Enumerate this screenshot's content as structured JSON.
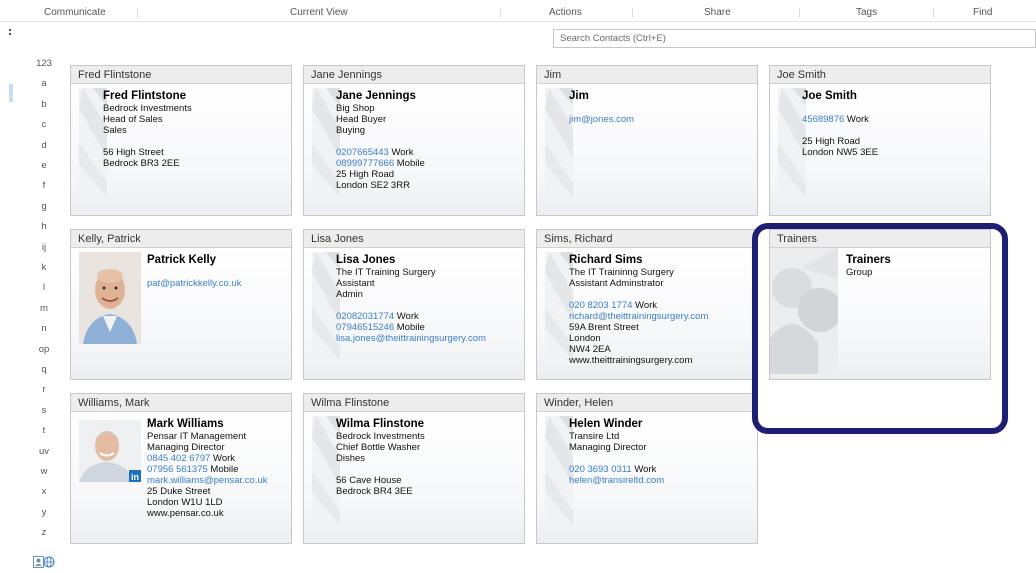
{
  "ribbon": {
    "groups": [
      "Communicate",
      "Current View",
      "Actions",
      "Share",
      "Tags",
      "Find"
    ]
  },
  "search": {
    "placeholder": "Search Contacts (Ctrl+E)"
  },
  "alphabet": [
    "123",
    "a",
    "b",
    "c",
    "d",
    "e",
    "f",
    "g",
    "h",
    "ij",
    "k",
    "l",
    "m",
    "n",
    "op",
    "q",
    "r",
    "s",
    "t",
    "uv",
    "w",
    "x",
    "y",
    "z"
  ],
  "cards": [
    {
      "header": "Fred Flintstone",
      "name": "Fred Flintstone",
      "lines": [
        {
          "text": "Bedrock Investments"
        },
        {
          "text": "Head of Sales"
        },
        {
          "text": "Sales"
        },
        {
          "gap": true
        },
        {
          "text": "56 High Street"
        },
        {
          "text": "Bedrock BR3 2EE"
        }
      ]
    },
    {
      "header": "Jane Jennings",
      "name": "Jane Jennings",
      "lines": [
        {
          "text": "Big Shop"
        },
        {
          "text": "Head Buyer"
        },
        {
          "text": "Buying"
        },
        {
          "gap": true
        },
        {
          "link": "0207665443",
          "suffix": " Work"
        },
        {
          "link": "08999777666",
          "suffix": " Mobile"
        },
        {
          "text": "25 High Road"
        },
        {
          "text": "London SE2 3RR"
        }
      ]
    },
    {
      "header": "Jim",
      "name": "Jim",
      "lines": [
        {
          "gap": true
        },
        {
          "link": "jim@jones.com"
        }
      ]
    },
    {
      "header": "Joe Smith",
      "name": "Joe Smith",
      "lines": [
        {
          "gap": true
        },
        {
          "link": "45689876",
          "suffix": " Work"
        },
        {
          "gap": true
        },
        {
          "text": "25 High Road"
        },
        {
          "text": "London NW5 3EE"
        }
      ]
    },
    {
      "header": "Kelly, Patrick",
      "name": "Patrick Kelly",
      "photo": "photo-patrick-kelly",
      "lines": [
        {
          "gap": true
        },
        {
          "link": "pat@patrickkelly.co.uk"
        }
      ]
    },
    {
      "header": "Lisa Jones",
      "name": "Lisa Jones",
      "lines": [
        {
          "text": "The IT Training Surgery"
        },
        {
          "text": "Assistant"
        },
        {
          "text": "Admin"
        },
        {
          "gap": true
        },
        {
          "link": "02082031774",
          "suffix": " Work"
        },
        {
          "link": "07946515246",
          "suffix": " Mobile"
        },
        {
          "link": "lisa.jones@theittrainingsurgery.com"
        }
      ]
    },
    {
      "header": "Sims, Richard",
      "name": "Richard Sims",
      "lines": [
        {
          "text": "The IT Traininng Surgery"
        },
        {
          "text": "Assistant Adminstrator"
        },
        {
          "gap": true
        },
        {
          "link": "020 8203 1774",
          "suffix": " Work"
        },
        {
          "link": "richard@theittrainingsurgery.com"
        },
        {
          "text": "59A Brent Street"
        },
        {
          "text": "London"
        },
        {
          "text": "NW4 2EA"
        },
        {
          "text": "www.theittrainingsurgery.com"
        }
      ]
    },
    {
      "header": "Trainers",
      "name": "Trainers",
      "group": true,
      "lines": [
        {
          "text": "Group"
        }
      ]
    },
    {
      "header": "Williams, Mark",
      "name": "Mark Williams",
      "photo": "photo-mark-williams",
      "lines": [
        {
          "text": "Pensar IT Management"
        },
        {
          "text": "Managing Director"
        },
        {
          "link": "0845 402 6797",
          "suffix": " Work"
        },
        {
          "link": "07956 561375",
          "suffix": " Mobile"
        },
        {
          "link": "mark.williams@pensar.co.uk"
        },
        {
          "text": "25 Duke Street"
        },
        {
          "text": "London W1U 1LD"
        },
        {
          "text": "www.pensar.co.uk"
        }
      ]
    },
    {
      "header": "Wilma Flinstone",
      "name": "Wilma Flinstone",
      "lines": [
        {
          "text": "Bedrock Investments"
        },
        {
          "text": "Chief Bottle Washer"
        },
        {
          "text": "Dishes"
        },
        {
          "gap": true
        },
        {
          "text": "56 Cave House"
        },
        {
          "text": "Bedrock BR4 3EE"
        }
      ]
    },
    {
      "header": "Winder, Helen",
      "name": "Helen Winder",
      "lines": [
        {
          "text": "Transire Ltd"
        },
        {
          "text": "Managing Director"
        },
        {
          "gap": true
        },
        {
          "link": "020 3693 0311",
          "suffix": " Work"
        },
        {
          "link": "helen@transireltd.com"
        }
      ]
    }
  ],
  "colors": {
    "link": "#3b7ec8",
    "highlight": "#1d1f72",
    "header_bg": "#ededed"
  },
  "icons": {
    "people": "people-globe-icon"
  }
}
